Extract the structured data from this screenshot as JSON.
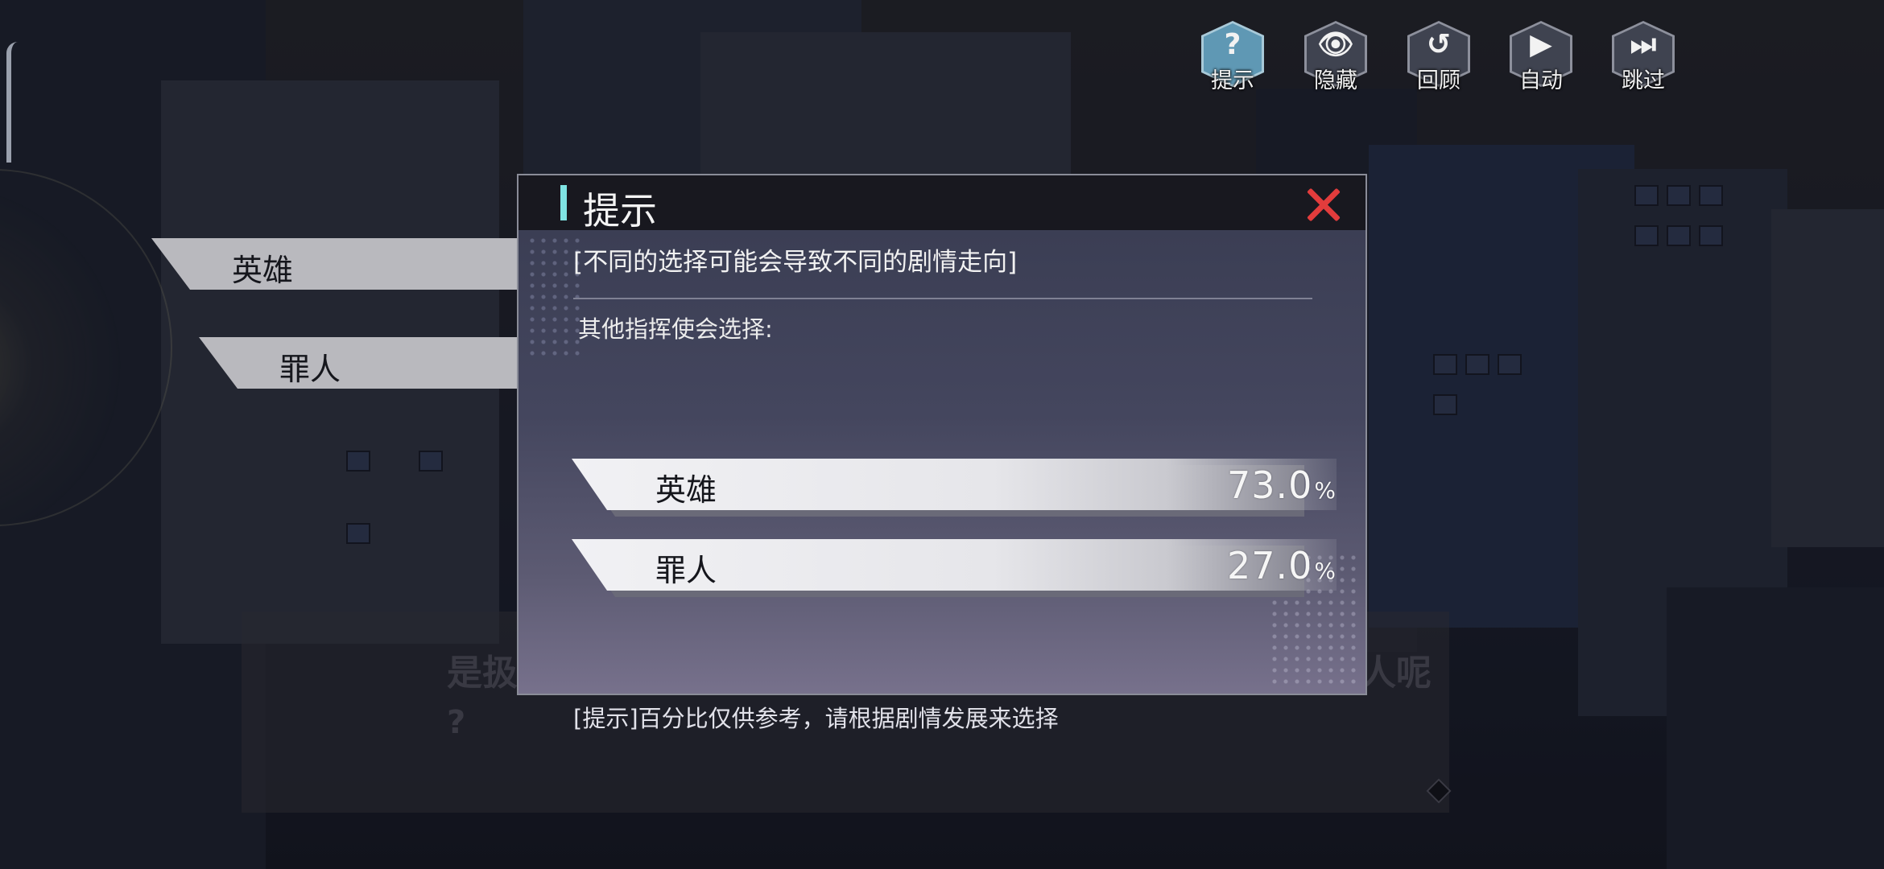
{
  "toolbar": {
    "items": [
      {
        "label": "提示",
        "glyph": "?",
        "icon": "hint-question-icon",
        "active": true
      },
      {
        "label": "隐藏",
        "glyph": "👁",
        "icon": "hide-eye-icon",
        "active": false
      },
      {
        "label": "回顾",
        "glyph": "↺",
        "icon": "history-clock-icon",
        "active": false
      },
      {
        "label": "自动",
        "glyph": "▶",
        "icon": "auto-play-icon",
        "active": false
      },
      {
        "label": "跳过",
        "glyph": "⏭",
        "icon": "skip-forward-icon",
        "active": false
      }
    ]
  },
  "choices": [
    {
      "label": "英雄"
    },
    {
      "label": "罪人"
    }
  ],
  "dialogue": {
    "line_start": "是扱",
    "line_end": "人呢",
    "line2": "?"
  },
  "hint_modal": {
    "title": "提示",
    "warning": "[不同的选择可能会导致不同的剧情走向]",
    "others_label": "其他指挥使会选择:",
    "stats": [
      {
        "label": "英雄",
        "value": "73.0",
        "unit": "%",
        "percent": 73.0
      },
      {
        "label": "罪人",
        "value": "27.0",
        "unit": "%",
        "percent": 27.0
      }
    ],
    "note": "[提示]百分比仅供参考，请根据剧情发展来选择"
  },
  "colors": {
    "accent_bar": "#7fe3e3",
    "close": "#e23c3c",
    "active_button": "#5f98b4"
  }
}
